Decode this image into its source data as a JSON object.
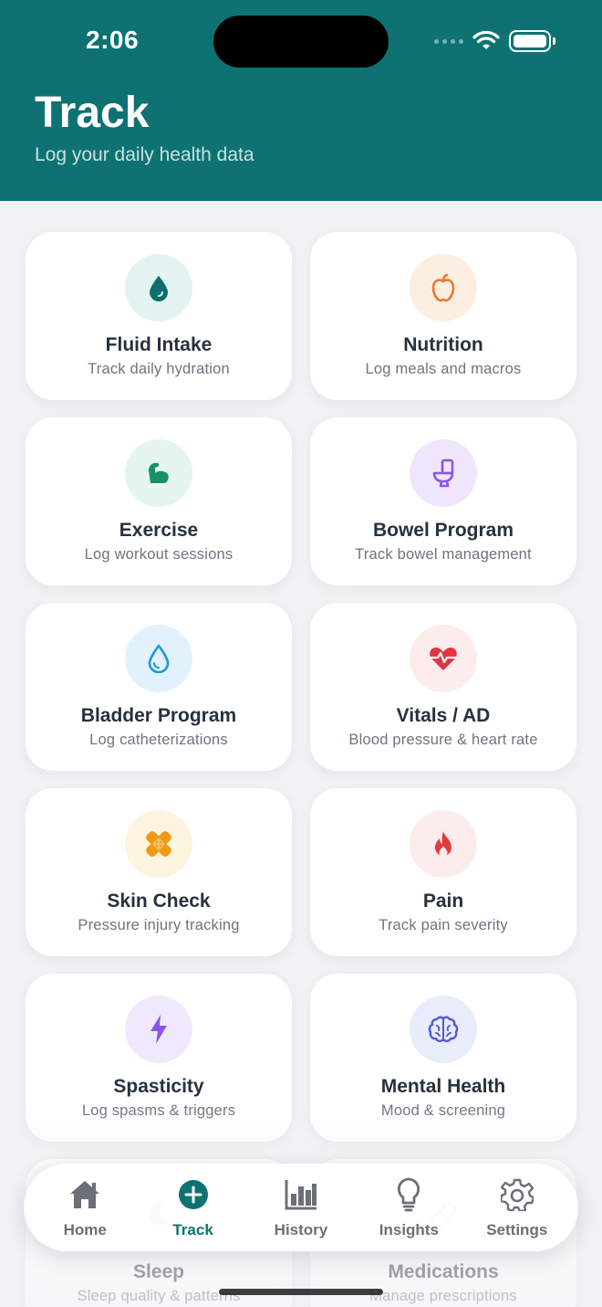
{
  "status_bar": {
    "time": "2:06"
  },
  "header": {
    "title": "Track",
    "subtitle": "Log your daily health data"
  },
  "cards": [
    {
      "title": "Fluid Intake",
      "subtitle": "Track daily hydration",
      "icon": "water-drop-icon",
      "color": "#0f6e6e",
      "bg": "#e3f3f1"
    },
    {
      "title": "Nutrition",
      "subtitle": "Log meals and macros",
      "icon": "apple-icon",
      "color": "#ea7a2f",
      "bg": "#fdeee2"
    },
    {
      "title": "Exercise",
      "subtitle": "Log workout sessions",
      "icon": "flexed-bicep-icon",
      "color": "#17906a",
      "bg": "#e4f6ee"
    },
    {
      "title": "Bowel Program",
      "subtitle": "Track bowel management",
      "icon": "toilet-icon",
      "color": "#8b56e6",
      "bg": "#efe6fd"
    },
    {
      "title": "Bladder Program",
      "subtitle": "Log catheterizations",
      "icon": "droplet-outline-icon",
      "color": "#1b9bd7",
      "bg": "#e1f2fc"
    },
    {
      "title": "Vitals / AD",
      "subtitle": "Blood pressure & heart rate",
      "icon": "heart-pulse-icon",
      "color": "#e0363f",
      "bg": "#fdecec"
    },
    {
      "title": "Skin Check",
      "subtitle": "Pressure injury tracking",
      "icon": "bandage-icon",
      "color": "#ef9a14",
      "bg": "#fdf4df"
    },
    {
      "title": "Pain",
      "subtitle": "Track pain severity",
      "icon": "flame-icon",
      "color": "#e23b3b",
      "bg": "#fdecec"
    },
    {
      "title": "Spasticity",
      "subtitle": "Log spasms & triggers",
      "icon": "lightning-bolt-icon",
      "color": "#8b56e6",
      "bg": "#f0e9fd"
    },
    {
      "title": "Mental Health",
      "subtitle": "Mood & screening",
      "icon": "brain-icon",
      "color": "#5159d8",
      "bg": "#e8ecfb"
    },
    {
      "title": "Sleep",
      "subtitle": "Sleep quality & patterns",
      "icon": "moon-icon",
      "color": "#5159d8",
      "bg": "#e8ecfb"
    },
    {
      "title": "Medications",
      "subtitle": "Manage prescriptions",
      "icon": "pill-icon",
      "color": "#17906a",
      "bg": "#e4f6ee"
    }
  ],
  "tabbar": [
    {
      "label": "Home",
      "icon": "house-icon"
    },
    {
      "label": "Track",
      "icon": "plus-circle-icon",
      "active": true
    },
    {
      "label": "History",
      "icon": "bar-chart-icon"
    },
    {
      "label": "Insights",
      "icon": "lightbulb-icon"
    },
    {
      "label": "Settings",
      "icon": "gear-icon"
    }
  ],
  "colors": {
    "header": "#0f7272",
    "active_tab": "#0f7272",
    "background": "#f2f2f5"
  }
}
